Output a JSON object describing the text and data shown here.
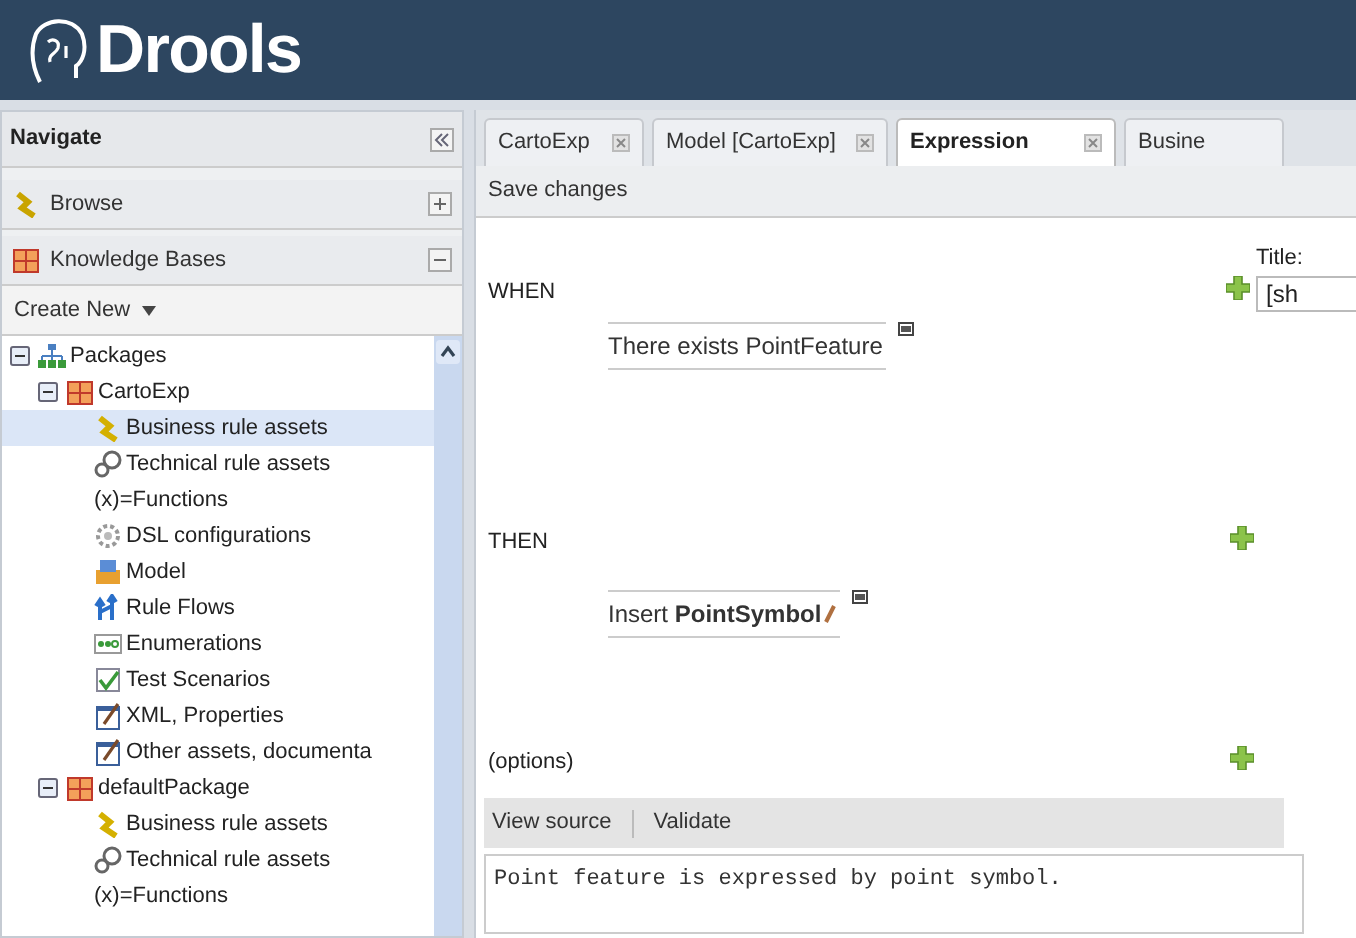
{
  "header": {
    "logo": "Drools"
  },
  "navigate": {
    "title": "Navigate",
    "sections": [
      {
        "label": "Browse",
        "expanded": false,
        "kind": "browse"
      },
      {
        "label": "Knowledge Bases",
        "expanded": true,
        "kind": "package"
      }
    ],
    "create_new": "Create New",
    "tree": [
      {
        "label": "Packages",
        "kind": "packages",
        "expanded": true,
        "selected": false,
        "children": [
          {
            "label": "CartoExp",
            "kind": "package",
            "expanded": true,
            "selected": false,
            "children": [
              {
                "label": "Business rule assets",
                "kind": "business",
                "selected": true
              },
              {
                "label": "Technical rule assets",
                "kind": "technical",
                "selected": false
              },
              {
                "label": "(x)=Functions",
                "kind": "plain",
                "selected": false
              },
              {
                "label": "DSL configurations",
                "kind": "dsl",
                "selected": false
              },
              {
                "label": "Model",
                "kind": "model",
                "selected": false
              },
              {
                "label": "Rule Flows",
                "kind": "flow",
                "selected": false
              },
              {
                "label": "Enumerations",
                "kind": "enum",
                "selected": false
              },
              {
                "label": "Test Scenarios",
                "kind": "test",
                "selected": false
              },
              {
                "label": "XML, Properties",
                "kind": "doc",
                "selected": false
              },
              {
                "label": "Other assets, documenta",
                "kind": "doc",
                "selected": false
              }
            ]
          },
          {
            "label": "defaultPackage",
            "kind": "package",
            "expanded": true,
            "selected": false,
            "children": [
              {
                "label": "Business rule assets",
                "kind": "business",
                "selected": false
              },
              {
                "label": "Technical rule assets",
                "kind": "technical",
                "selected": false
              },
              {
                "label": "(x)=Functions",
                "kind": "plain",
                "selected": false
              }
            ]
          }
        ]
      }
    ]
  },
  "tabs": [
    {
      "label": "CartoExp",
      "selected": false
    },
    {
      "label": "Model [CartoExp]",
      "selected": false
    },
    {
      "label": "Expression",
      "selected": true
    },
    {
      "label": "Busine",
      "selected": false
    }
  ],
  "toolbar": {
    "save": "Save changes"
  },
  "editor": {
    "when": "WHEN",
    "conditions": [
      "There exists PointFeature"
    ],
    "then": "THEN",
    "actions": [
      "Insert **PointSymbol**"
    ],
    "options": "(options)",
    "title_label": "Title:",
    "title_value": "[sh"
  },
  "source_bar": [
    "View source",
    "Validate"
  ],
  "description": "Point feature is expressed by point symbol."
}
